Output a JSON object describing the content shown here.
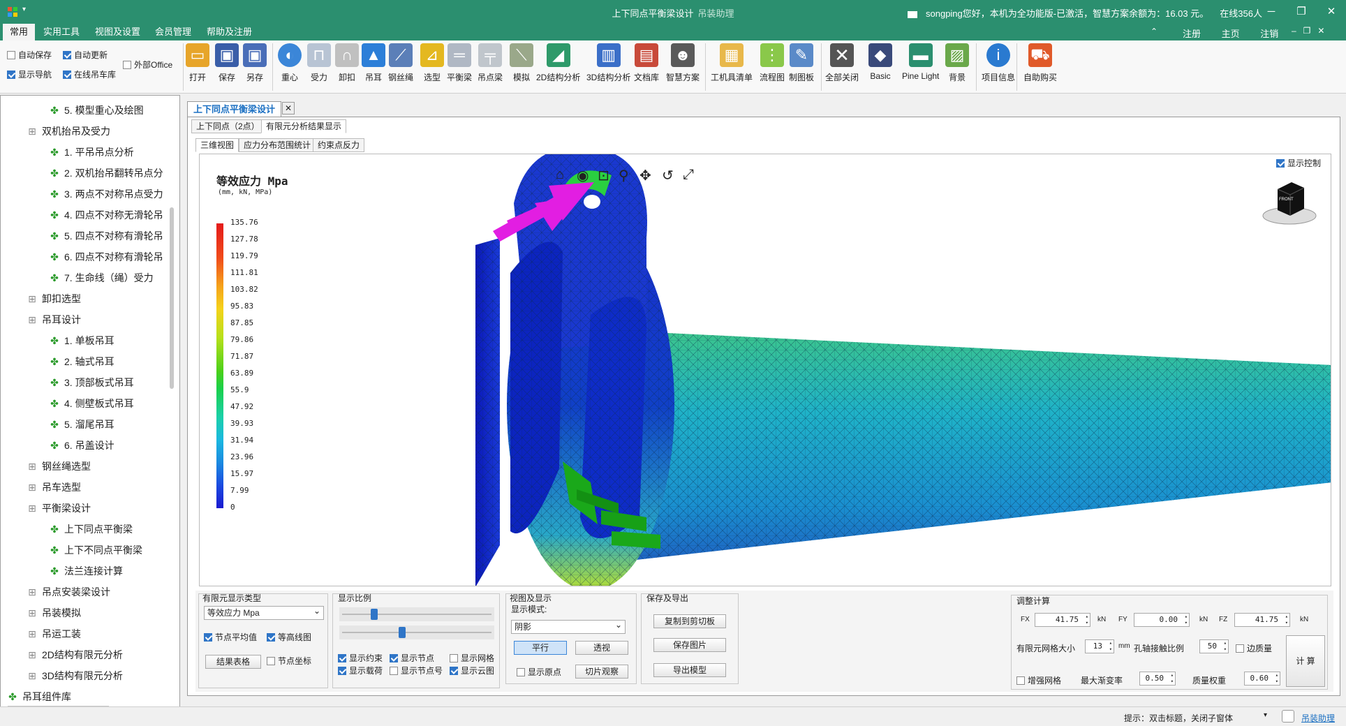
{
  "app": {
    "title": "上下同点平衡梁设计",
    "subtitle": "吊装助理",
    "user_info": "songping您好，本机为全功能版-已激活，智慧方案余额为：16.03 元。",
    "online": "在线356人"
  },
  "menu": [
    "常用",
    "实用工具",
    "视图及设置",
    "会员管理",
    "帮助及注册"
  ],
  "menu_right": [
    "注册",
    "主页",
    "注销"
  ],
  "ribbon_checks": [
    {
      "label": "自动保存",
      "checked": false
    },
    {
      "label": "自动更新",
      "checked": true
    },
    {
      "label": "外部Office",
      "checked": false
    },
    {
      "label": "显示导航",
      "checked": true
    },
    {
      "label": "在线吊车库",
      "checked": true
    }
  ],
  "tools": [
    "打开",
    "保存",
    "另存",
    "重心",
    "受力",
    "卸扣",
    "吊耳",
    "钢丝绳",
    "选型",
    "平衡梁",
    "吊点梁",
    "模拟",
    "2D结构分析",
    "3D结构分析",
    "文档库",
    "智慧方案",
    "工机具清单",
    "流程图",
    "制图板",
    "全部关闭",
    "Basic",
    "Pine Light",
    "背景",
    "项目信息",
    "自助购买"
  ],
  "tree": [
    {
      "label": "5. 模型重心及绘图",
      "level": 3,
      "kind": "leaf"
    },
    {
      "label": "双机抬吊及受力",
      "level": 2,
      "kind": "folder"
    },
    {
      "label": "1. 平吊吊点分析",
      "level": 3,
      "kind": "leaf"
    },
    {
      "label": "2. 双机抬吊翻转吊点分",
      "level": 3,
      "kind": "leaf"
    },
    {
      "label": "3. 两点不对称吊点受力",
      "level": 3,
      "kind": "leaf"
    },
    {
      "label": "4. 四点不对称无滑轮吊",
      "level": 3,
      "kind": "leaf"
    },
    {
      "label": "5. 四点不对称有滑轮吊",
      "level": 3,
      "kind": "leaf"
    },
    {
      "label": "6. 四点不对称有滑轮吊",
      "level": 3,
      "kind": "leaf"
    },
    {
      "label": "7. 生命线（绳）受力",
      "level": 3,
      "kind": "leaf"
    },
    {
      "label": "卸扣选型",
      "level": 2,
      "kind": "folder"
    },
    {
      "label": "吊耳设计",
      "level": 2,
      "kind": "folder"
    },
    {
      "label": "1. 单板吊耳",
      "level": 3,
      "kind": "leaf"
    },
    {
      "label": "2. 轴式吊耳",
      "level": 3,
      "kind": "leaf"
    },
    {
      "label": "3. 顶部板式吊耳",
      "level": 3,
      "kind": "leaf"
    },
    {
      "label": "4. 侧壁板式吊耳",
      "level": 3,
      "kind": "leaf"
    },
    {
      "label": "5. 溜尾吊耳",
      "level": 3,
      "kind": "leaf"
    },
    {
      "label": "6. 吊盖设计",
      "level": 3,
      "kind": "leaf"
    },
    {
      "label": "钢丝绳选型",
      "level": 2,
      "kind": "folder"
    },
    {
      "label": "吊车选型",
      "level": 2,
      "kind": "folder"
    },
    {
      "label": "平衡梁设计",
      "level": 2,
      "kind": "folder"
    },
    {
      "label": "上下同点平衡梁",
      "level": 3,
      "kind": "leaf"
    },
    {
      "label": "上下不同点平衡梁",
      "level": 3,
      "kind": "leaf"
    },
    {
      "label": "法兰连接计算",
      "level": 3,
      "kind": "leaf"
    },
    {
      "label": "吊点安装梁设计",
      "level": 2,
      "kind": "folder"
    },
    {
      "label": "吊装模拟",
      "level": 2,
      "kind": "folder"
    },
    {
      "label": "吊运工装",
      "level": 2,
      "kind": "folder"
    },
    {
      "label": "2D结构有限元分析",
      "level": 2,
      "kind": "folder"
    },
    {
      "label": "3D结构有限元分析",
      "level": 2,
      "kind": "folder"
    },
    {
      "label": "吊耳组件库",
      "level": 1,
      "kind": "leaf"
    }
  ],
  "doc_tab": "上下同点平衡梁设计",
  "sub_tabs": [
    "上下同点（2点）",
    "有限元分析结果显示"
  ],
  "view_tabs": [
    "三维视图",
    "应力分布范围统计",
    "约束点反力"
  ],
  "viewport": {
    "legend_title": "等效应力 Mpa",
    "legend_unit": "(mm, kN, MPa)",
    "legend_values": [
      "135.76",
      "127.78",
      "119.79",
      "111.81",
      "103.82",
      "95.83",
      "87.85",
      "79.86",
      "71.87",
      "63.89",
      "55.9",
      "47.92",
      "39.93",
      "31.94",
      "23.96",
      "15.97",
      "7.99",
      "0"
    ],
    "show_control": "显示控制",
    "cube_label": "FRONT"
  },
  "panel": {
    "fe_type": {
      "title": "有限元显示类型",
      "select": "等效应力 Mpa",
      "node_avg": "节点平均值",
      "contour": "等高线图",
      "result_table": "结果表格",
      "node_coord": "节点坐标"
    },
    "scale": {
      "title": "显示比例",
      "slider1": 0.21,
      "slider2": 0.4,
      "checks": [
        "显示约束",
        "显示节点",
        "显示网格",
        "显示载荷",
        "显示节点号",
        "显示云图"
      ]
    },
    "view": {
      "title": "视图及显示",
      "mode_label": "显示模式:",
      "mode": "阴影",
      "parallel": "平行",
      "perspective": "透视",
      "show_origin": "显示原点",
      "slice": "切片观察"
    },
    "save": {
      "title": "保存及导出",
      "copy": "复制到剪切板",
      "save_img": "保存图片",
      "export": "导出模型"
    },
    "calc": {
      "title": "调整计算",
      "fx_label": "FX",
      "fx": "41.75",
      "fy_label": "FY",
      "fy": "0.00",
      "fz_label": "FZ",
      "fz": "41.75",
      "unit_kn": "kN",
      "mesh_label": "有限元网格大小",
      "mesh": "13",
      "mm": "mm",
      "contact_label": "孔轴接触比例",
      "contact": "50",
      "edge_mass": "边质量",
      "refine": "增强网格",
      "max_grad_label": "最大渐变率",
      "max_grad": "0.50",
      "mass_weight_label": "质量权重",
      "mass_weight": "0.60",
      "calc_btn": "计 算"
    }
  },
  "status": {
    "hint": "提示：双击标题，关闭子窗体",
    "link": "吊装助理"
  }
}
